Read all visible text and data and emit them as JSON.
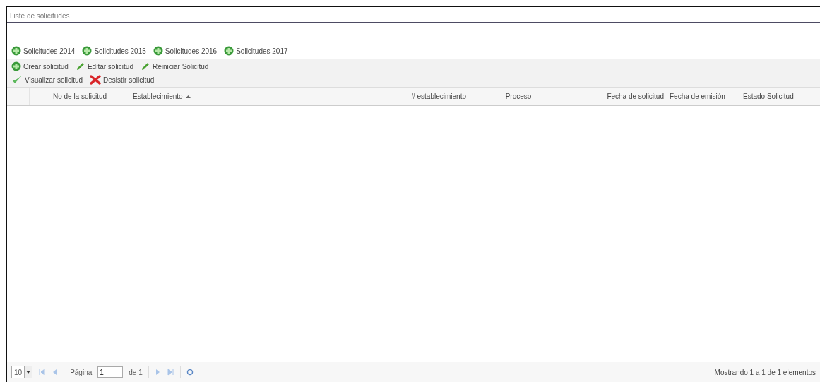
{
  "panel": {
    "title": "Liste de solicitudes"
  },
  "year_buttons": [
    {
      "label": "Solicitudes 2014"
    },
    {
      "label": "Solicitudes 2015"
    },
    {
      "label": "Solicitudes 2016"
    },
    {
      "label": "Solicitudes 2017"
    }
  ],
  "toolbar": [
    [
      {
        "label": "Crear solicitud",
        "kind": "add"
      },
      {
        "label": "Editar solicitud",
        "kind": "edit"
      },
      {
        "label": "Reiniciar Solicitud",
        "kind": "edit"
      }
    ],
    [
      {
        "label": "Visualizar solicitud",
        "kind": "view"
      },
      {
        "label": "Desistir solicitud",
        "kind": "delete"
      }
    ]
  ],
  "table": {
    "columns": [
      {
        "label": "No de la solicitud",
        "sorted": false
      },
      {
        "label": "Establecimiento",
        "sorted": true
      },
      {
        "label": "# establecimiento",
        "sorted": false
      },
      {
        "label": "Proceso",
        "sorted": false
      },
      {
        "label": "Fecha de solicitud",
        "sorted": false
      },
      {
        "label": "Fecha de emisión",
        "sorted": false
      },
      {
        "label": "Estado Solicitud",
        "sorted": false
      }
    ]
  },
  "pager": {
    "page_size": "10",
    "page_label": "Página",
    "page": "1",
    "of_label": "de 1",
    "summary": "Mostrando 1 a 1 de 1 elementos"
  }
}
